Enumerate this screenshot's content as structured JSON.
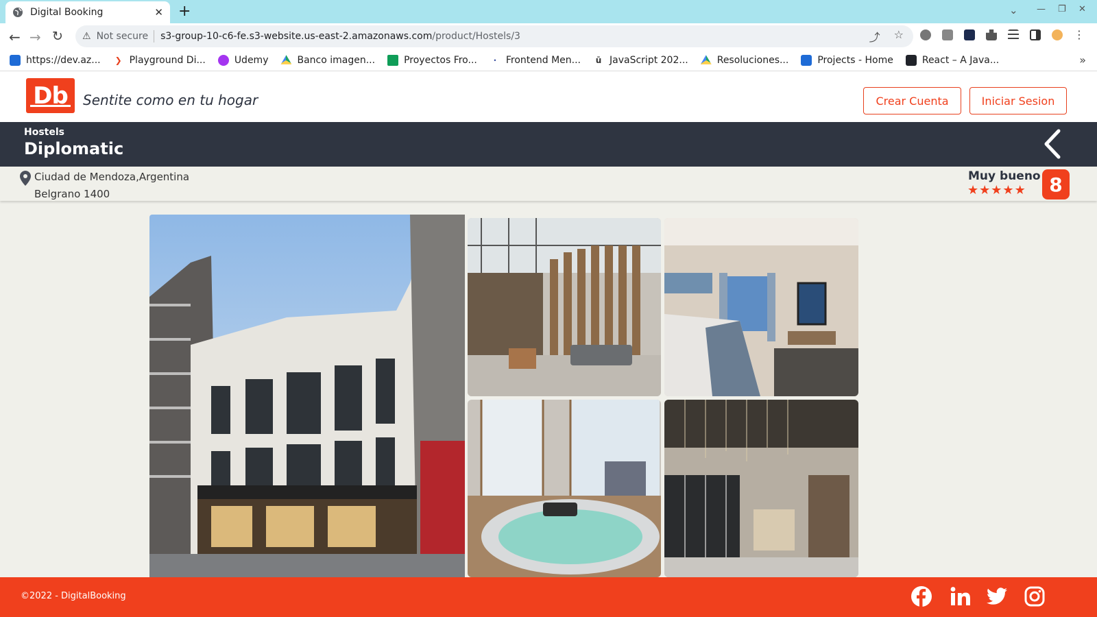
{
  "browser": {
    "tab_title": "Digital Booking",
    "address": {
      "security_label": "Not secure",
      "host": "s3-group-10-c6-fe.s3-website.us-east-2.amazonaws.com",
      "path": "/product/Hostels/3"
    },
    "bookmarks": [
      {
        "label": "https://dev.az...",
        "icon": "azure-devops-icon",
        "color": "#1e6bd6"
      },
      {
        "label": "Playground Di...",
        "icon": "chevron-right-icon",
        "color": "#e8401d"
      },
      {
        "label": "Udemy",
        "icon": "udemy-icon",
        "color": "#a435f0"
      },
      {
        "label": "Banco imagen...",
        "icon": "google-drive-icon",
        "color": "#1fa463"
      },
      {
        "label": "Proyectos Fro...",
        "icon": "sheets-icon",
        "color": "#0f9d58"
      },
      {
        "label": "Frontend Men...",
        "icon": "frontend-mentor-icon",
        "color": "#3e54a3"
      },
      {
        "label": "JavaScript 202...",
        "icon": "javascript-icon",
        "color": "#333333"
      },
      {
        "label": "Resoluciones...",
        "icon": "google-drive-icon",
        "color": "#1fa463"
      },
      {
        "label": "Projects - Home",
        "icon": "azure-devops-icon",
        "color": "#1e6bd6"
      },
      {
        "label": "React – A Java...",
        "icon": "react-icon",
        "color": "#20232a"
      }
    ]
  },
  "header": {
    "logo_text": "Db",
    "tagline": "Sentite como en tu hogar",
    "create_account": "Crear Cuenta",
    "login": "Iniciar Sesion"
  },
  "product": {
    "category": "Hostels",
    "name": "Diplomatic",
    "city": "Ciudad de Mendoza,Argentina",
    "address": "Belgrano 1400",
    "rating_label": "Muy bueno",
    "stars": 5,
    "score": "8"
  },
  "gallery": [
    {
      "label": "hotel facade"
    },
    {
      "label": "lobby lounge"
    },
    {
      "label": "bedroom"
    },
    {
      "label": "jacuzzi"
    },
    {
      "label": "reception"
    }
  ],
  "footer": {
    "copyright": "©2022 - DigitalBooking",
    "social": [
      "facebook-icon",
      "linkedin-icon",
      "twitter-icon",
      "instagram-icon"
    ]
  },
  "colors": {
    "brand": "#f0401d",
    "dark": "#2f3541",
    "background": "#f0f0ea"
  }
}
